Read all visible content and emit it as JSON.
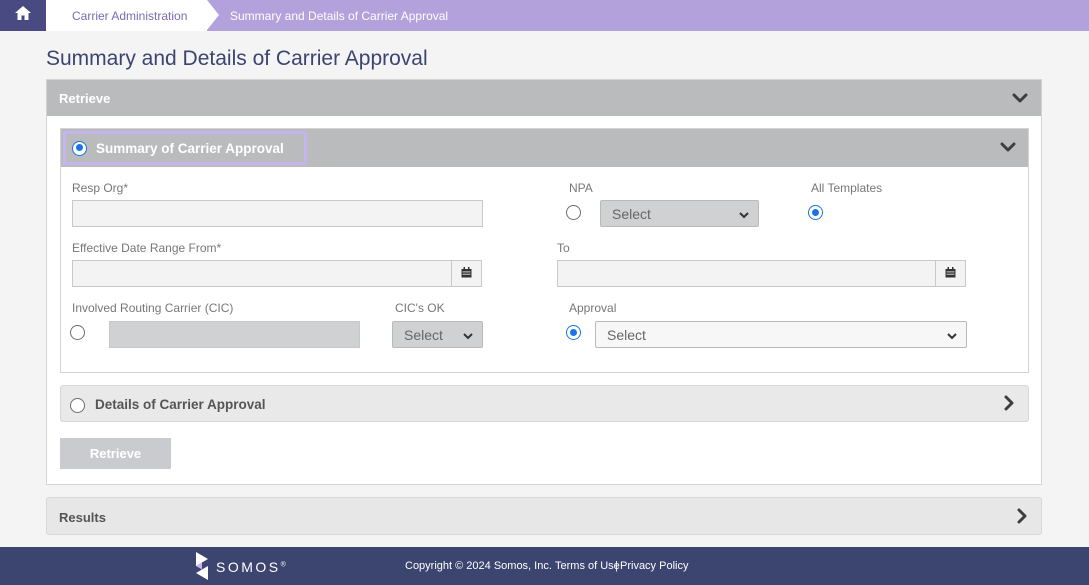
{
  "breadcrumb": {
    "home_icon": "home-icon",
    "item1": "Carrier Administration",
    "item2": "Summary and Details of Carrier Approval"
  },
  "page_title": "Summary and Details of Carrier Approval",
  "retrieve_panel": {
    "label": "Retrieve",
    "summary": {
      "label": "Summary of Carrier Approval",
      "selected": true,
      "resp_org_label": "Resp Org*",
      "resp_org_value": "",
      "npa_label": "NPA",
      "npa_select": "Select",
      "all_templates_label": "All Templates",
      "eff_date_from_label": "Effective Date Range From*",
      "eff_date_from_value": "",
      "to_label": "To",
      "to_value": "",
      "involved_cic_label": "Involved Routing Carrier (CIC)",
      "involved_cic_value": "",
      "cics_ok_label": "CIC's OK",
      "cics_ok_select": "Select",
      "approval_label": "Approval",
      "approval_select": "Select"
    },
    "details": {
      "label": "Details of Carrier Approval",
      "selected": false
    },
    "retrieve_button": "Retrieve"
  },
  "results_panel": {
    "label": "Results"
  },
  "footer": {
    "logo": "SOMOS",
    "logo_mark": "®",
    "copyright": "Copyright © 2024 Somos, Inc.",
    "terms": "Terms of Use",
    "separator": "|",
    "privacy": "Privacy Policy"
  },
  "colors": {
    "crumb_bar": "#b3a1dc",
    "home_bg": "#4a4a82",
    "header_gray": "#b9bbbd",
    "footer": "#3c4470",
    "radio_blue": "#1a73e8",
    "focus_ring": "#c6b4ee"
  }
}
